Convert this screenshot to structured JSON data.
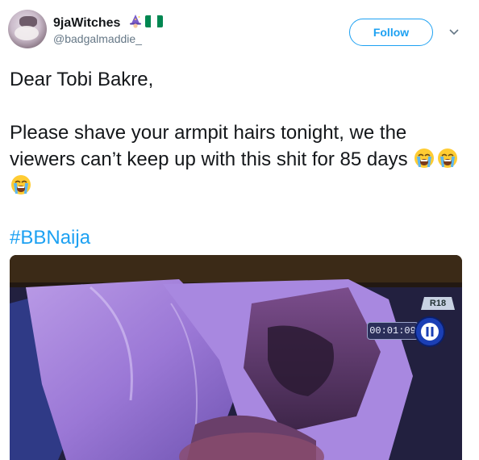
{
  "user": {
    "name": "9jaWitches",
    "handle": "@badgalmaddie_"
  },
  "follow_button": {
    "label": "Follow"
  },
  "tweet": {
    "greeting": "Dear Tobi Bakre,",
    "body": "Please shave your armpit hairs tonight, we the viewers can’t keep up with this shit for 85 days",
    "emojis": [
      "loudly-crying-face",
      "loudly-crying-face",
      "loudly-crying-face"
    ],
    "hashtag": "#BBNaija"
  },
  "media": {
    "timestamp": "00:01:09",
    "rating": "R18",
    "play_state": "paused"
  },
  "colors": {
    "accent": "#1da1f2",
    "text": "#14171a",
    "muted": "#657786",
    "flag_green": "#008751"
  }
}
